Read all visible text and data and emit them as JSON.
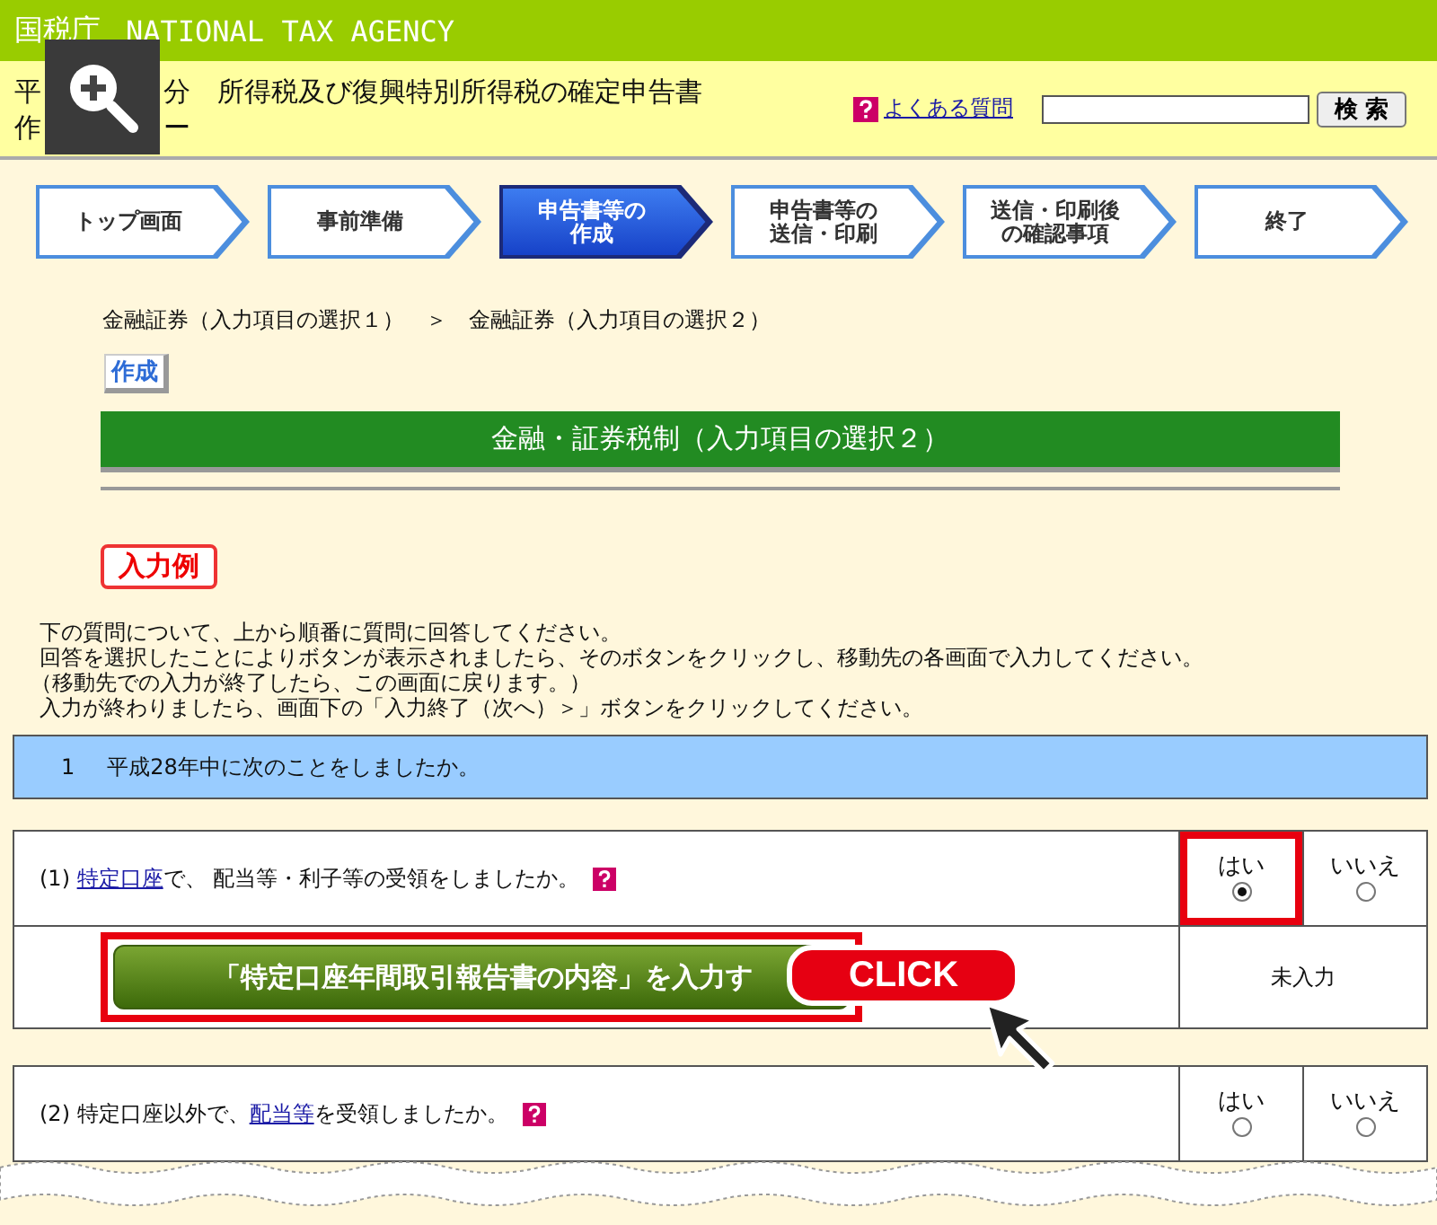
{
  "header": {
    "agency": "国税庁",
    "agency_en": "NATIONAL TAX AGENCY"
  },
  "title": {
    "line1_start": "平",
    "line1_end": "分　所得税及び復興特別所得税の確定申告書",
    "line2_start": "作",
    "line2_end": "ー"
  },
  "faq_link": "よくある質問",
  "search_button": "検 索",
  "steps": [
    {
      "lines": [
        "トップ画面"
      ],
      "selected": false
    },
    {
      "lines": [
        "事前準備"
      ],
      "selected": false
    },
    {
      "lines": [
        "申告書等の",
        "作成"
      ],
      "selected": true
    },
    {
      "lines": [
        "申告書等の",
        "送信・印刷"
      ],
      "selected": false
    },
    {
      "lines": [
        "送信・印刷後",
        "の確認事項"
      ],
      "selected": false
    },
    {
      "lines": [
        "終了"
      ],
      "selected": false
    }
  ],
  "breadcrumb": [
    "金融証券（入力項目の選択１）",
    "＞",
    "金融証券（入力項目の選択２）"
  ],
  "tag": "作成",
  "heading": "金融・証券税制（入力項目の選択２）",
  "example_button": "入力例",
  "instructions": [
    "下の質問について、上から順番に質問に回答してください。",
    "回答を選択したことによりボタンが表示されましたら、そのボタンをクリックし、移動先の各画面で入力してください。",
    "（移動先での入力が終了したら、この画面に戻ります。）",
    "入力が終わりましたら、画面下の「入力終了（次へ）＞」ボタンをクリックしてください。"
  ],
  "section": {
    "number": "1",
    "text": "平成28年中に次のことをしましたか。"
  },
  "questions": [
    {
      "number": "(1)",
      "segments": [
        {
          "kind": "link",
          "text": "特定口座"
        },
        {
          "kind": "plain",
          "text": "で、 配当等・利子等の受領をしましたか。"
        }
      ],
      "options": [
        {
          "label": "はい",
          "selected": true,
          "highlighted": true
        },
        {
          "label": "いいえ",
          "selected": false,
          "highlighted": false
        }
      ],
      "action": {
        "button": "「特定口座年間取引報告書の内容」を入力す",
        "highlighted": true,
        "status": "未入力"
      }
    },
    {
      "number": "(2)",
      "segments": [
        {
          "kind": "plain",
          "text": "特定口座以外で、"
        },
        {
          "kind": "link",
          "text": "配当等"
        },
        {
          "kind": "plain",
          "text": "を受領しましたか。"
        }
      ],
      "options": [
        {
          "label": "はい",
          "selected": false,
          "highlighted": false
        },
        {
          "label": "いいえ",
          "selected": false,
          "highlighted": false
        }
      ]
    }
  ],
  "click_badge": "CLICK"
}
